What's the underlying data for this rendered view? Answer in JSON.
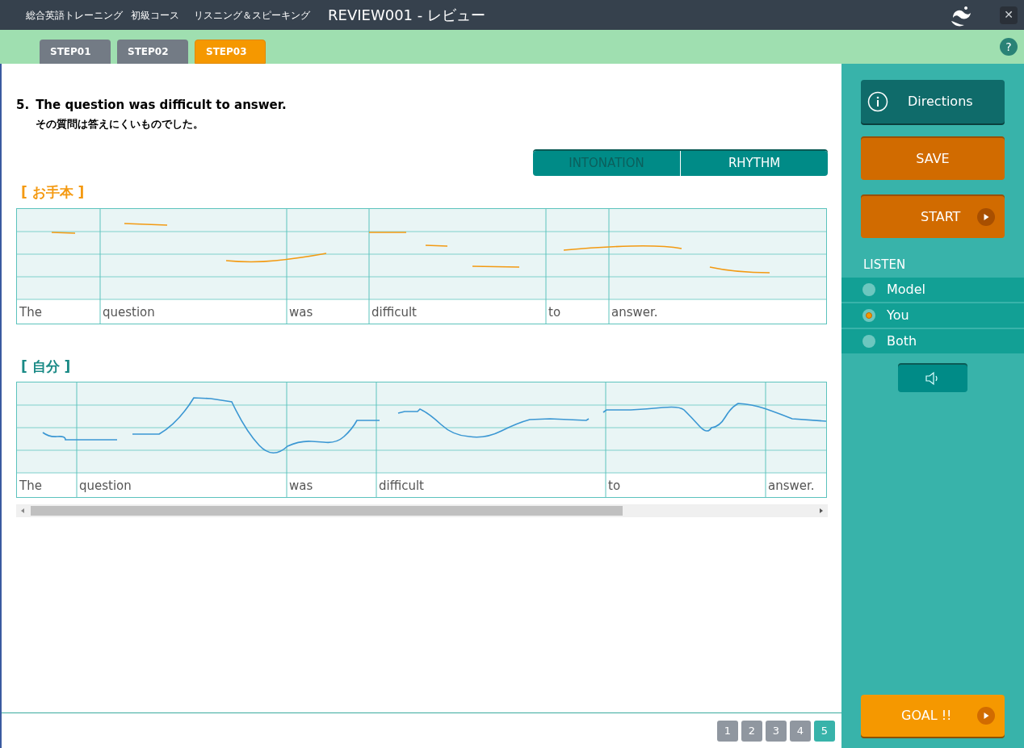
{
  "header": {
    "course": "総合英語トレーニング",
    "level": "初級コース",
    "section": "リスニング＆スピーキング",
    "title": "REVIEW001 - レビュー",
    "close": "✕"
  },
  "help": "?",
  "tabs": [
    {
      "label": "STEP01",
      "selected": false
    },
    {
      "label": "STEP02",
      "selected": false
    },
    {
      "label": "STEP03",
      "selected": true
    }
  ],
  "question": {
    "number": "5.",
    "english": "The question was difficult to answer.",
    "japanese": "その質問は答えにくいものでした。"
  },
  "view_toggle": [
    {
      "label": "INTONATION",
      "selected": false
    },
    {
      "label": "RHYTHM",
      "selected": true
    }
  ],
  "model_chart": {
    "label": "[ お手本 ]",
    "words": [
      "The",
      "question",
      "was",
      "difficult",
      "to",
      "answer."
    ]
  },
  "user_chart": {
    "label": "[ 自分 ]",
    "words": [
      "The",
      "question",
      "was",
      "difficult",
      "to",
      "answer."
    ]
  },
  "side": {
    "directions": "Directions",
    "save": "SAVE",
    "start": "START",
    "listen_label": "LISTEN",
    "listen_options": [
      {
        "label": "Model",
        "selected": false
      },
      {
        "label": "You",
        "selected": true
      },
      {
        "label": "Both",
        "selected": false
      }
    ],
    "goal": "GOAL !!"
  },
  "pages": [
    {
      "label": "1",
      "selected": false
    },
    {
      "label": "2",
      "selected": false
    },
    {
      "label": "3",
      "selected": false
    },
    {
      "label": "4",
      "selected": false
    },
    {
      "label": "5",
      "selected": true
    }
  ]
}
